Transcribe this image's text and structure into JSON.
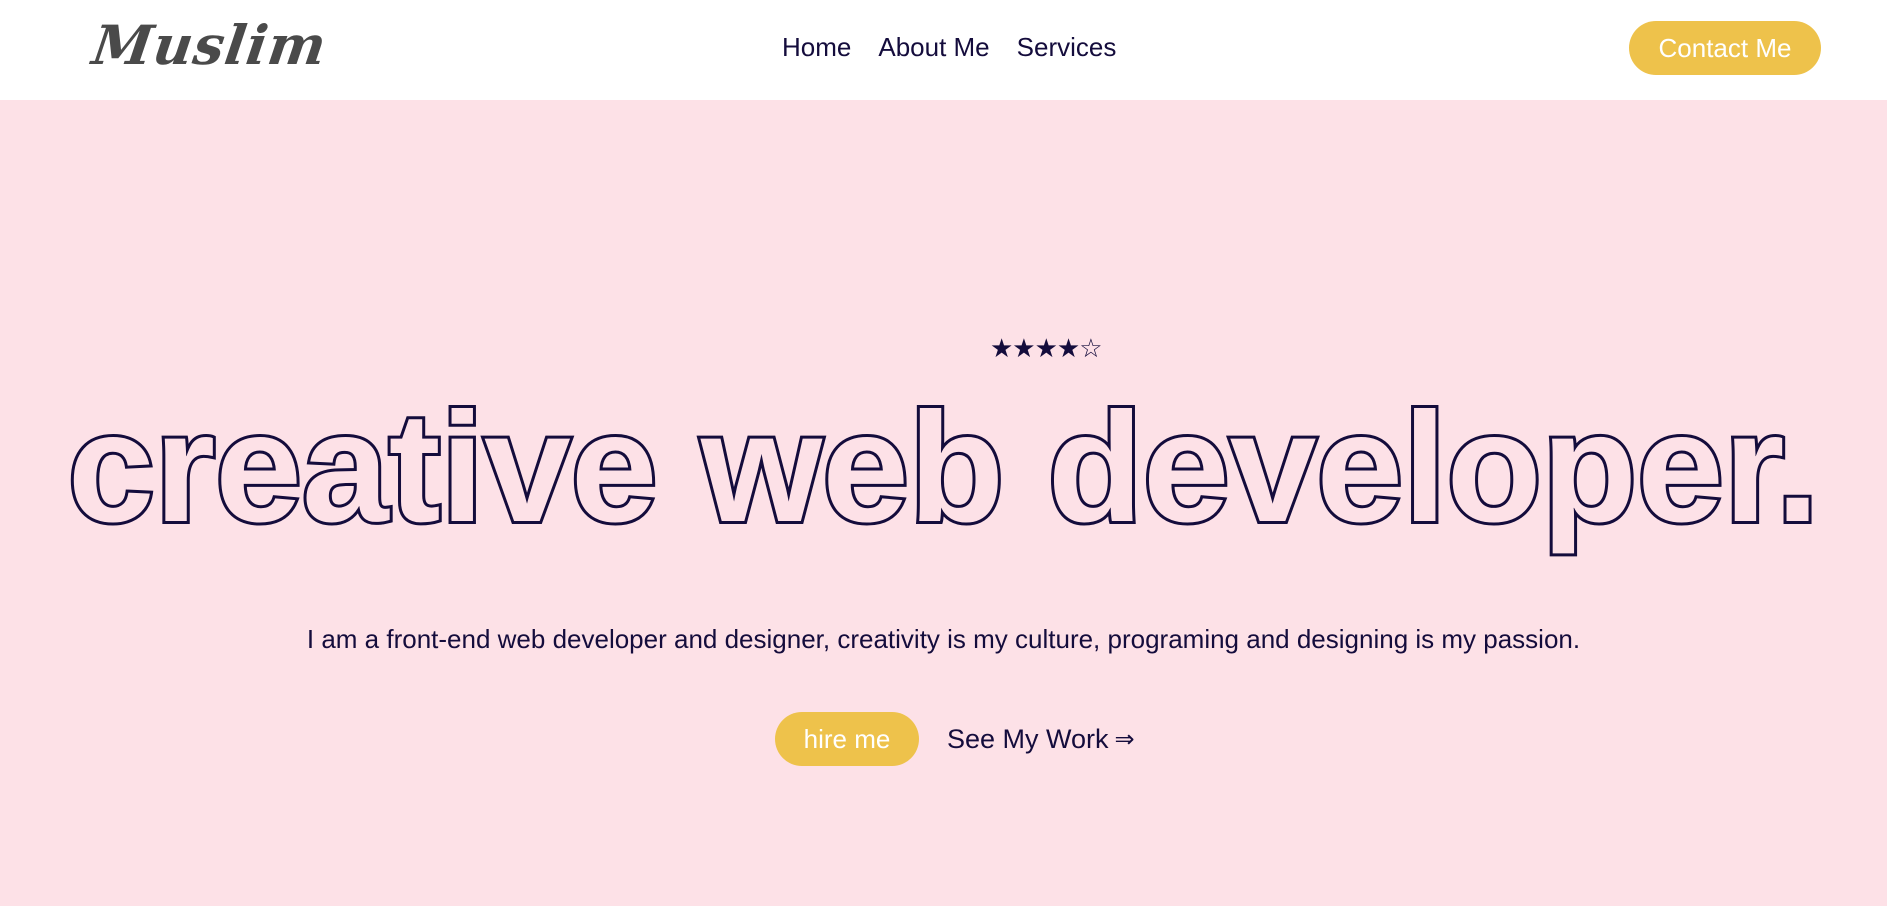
{
  "header": {
    "logo": "Muslim",
    "nav": [
      {
        "label": "Home"
      },
      {
        "label": "About Me"
      },
      {
        "label": "Services"
      }
    ],
    "contact_label": "Contact Me"
  },
  "hero": {
    "rating": {
      "stars_filled": 4,
      "stars_total": 5,
      "display": "★★★★☆"
    },
    "headline": "creative web developer.",
    "tagline": "I am a front-end web developer and designer, creativity is my culture, programing and designing is my passion.",
    "hire_label": "hire me",
    "see_work_label": "See My Work",
    "see_work_arrow": "⇒"
  },
  "colors": {
    "background": "#fde1e7",
    "header_bg": "#ffffff",
    "accent": "#eec24b",
    "text": "#140c3c",
    "logo": "#4a4a4a"
  }
}
